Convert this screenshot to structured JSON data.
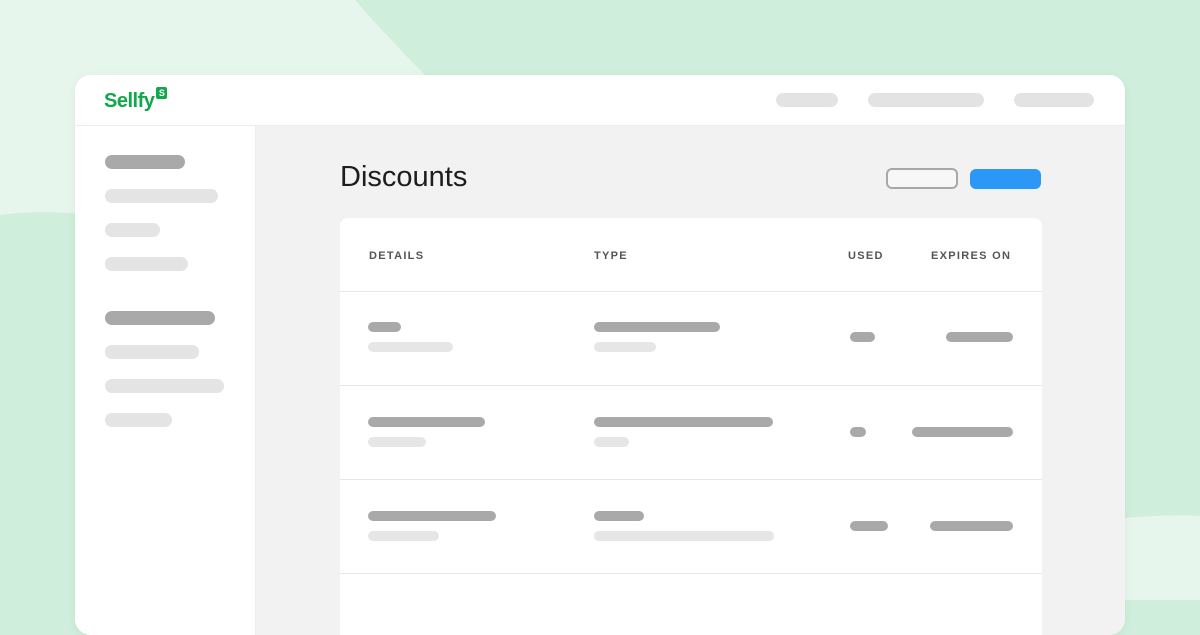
{
  "app": {
    "brand_name": "Sellfy",
    "brand_badge": "S",
    "brand_color": "#0fa84a"
  },
  "page": {
    "title": "Discounts"
  },
  "table": {
    "columns": [
      "DETAILS",
      "TYPE",
      "USED",
      "EXPIRES ON"
    ]
  },
  "colors": {
    "background": "#cfeedb",
    "primary_button": "#2b97f7",
    "placeholder_dark": "#a9a9a9",
    "placeholder_light": "#e6e6e6"
  }
}
